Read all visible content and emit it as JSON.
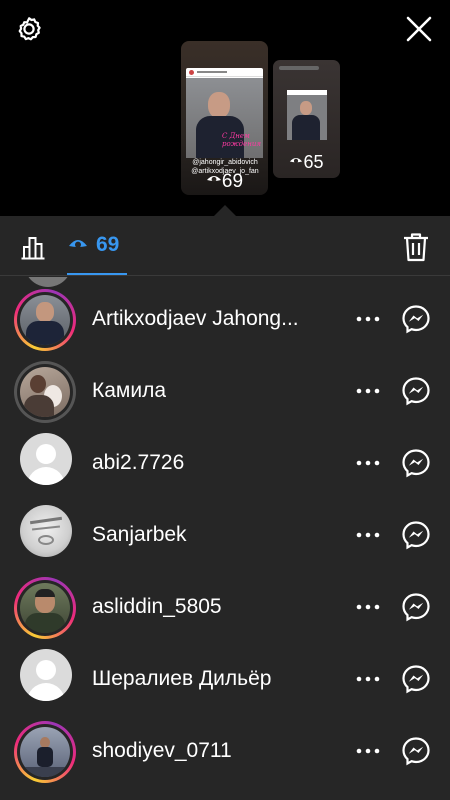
{
  "top": {
    "main_story": {
      "caption_line1": "@jahongir_abidovich",
      "caption_line2": "@artikxodjaev_jo_fan",
      "card_overlay_text": "С Днем рождения",
      "views": "69"
    },
    "second_story": {
      "views": "65"
    }
  },
  "tabs": {
    "viewers_count": "69"
  },
  "viewers": [
    {
      "username": "Artikxodjaev Jahong...",
      "avatar": "photo",
      "ring": "story"
    },
    {
      "username": "Камила",
      "avatar": "photo",
      "ring": "grey"
    },
    {
      "username": "abi2.7726",
      "avatar": "default",
      "ring": "none"
    },
    {
      "username": "Sanjarbek",
      "avatar": "photo",
      "ring": "none"
    },
    {
      "username": "asliddin_5805",
      "avatar": "photo",
      "ring": "story"
    },
    {
      "username": "Шералиев Дильёр",
      "avatar": "default",
      "ring": "none"
    },
    {
      "username": "shodiyev_0711",
      "avatar": "photo",
      "ring": "story"
    }
  ],
  "colors": {
    "accent": "#3897f0",
    "sheet": "#262626",
    "background": "#000000"
  },
  "icons": [
    "gear-icon",
    "close-icon",
    "insights-icon",
    "eye-icon",
    "trash-icon",
    "more-icon",
    "messenger-icon"
  ]
}
